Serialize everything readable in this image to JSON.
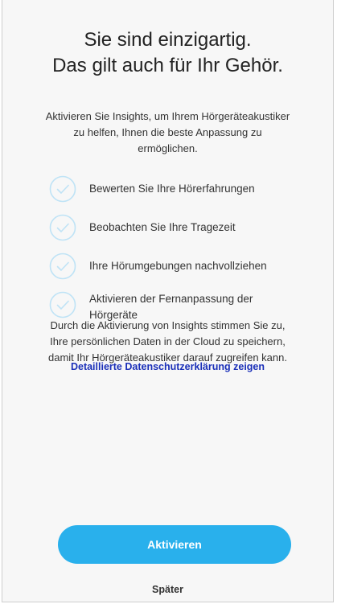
{
  "headline": {
    "line1": "Sie sind einzigartig.",
    "line2": "Das gilt auch für Ihr Gehör."
  },
  "intro": {
    "line1": "Aktivieren Sie Insights, um Ihrem Hörgeräteakustiker",
    "line2": "zu helfen, Ihnen die beste Anpassung zu",
    "line3": "ermöglichen."
  },
  "features": [
    {
      "icon": "check-circle-icon",
      "label": "Bewerten Sie Ihre Hörerfahrungen"
    },
    {
      "icon": "check-circle-icon",
      "label": "Beobachten Sie Ihre Tragezeit"
    },
    {
      "icon": "check-circle-icon",
      "label": "Ihre Hörumgebungen nachvollziehen"
    },
    {
      "icon": "check-circle-icon",
      "label": "Aktivieren der Fernanpassung der Hörgeräte"
    }
  ],
  "consent": {
    "line1": "Durch die Aktivierung von Insights stimmen Sie zu,",
    "line2": "Ihre persönlichen Daten in der Cloud zu speichern,",
    "line3": "damit Ihr Hörgeräteakustiker darauf zugreifen kann."
  },
  "privacy_link": "Detaillierte Datenschutzerklärung zeigen",
  "activate_button": "Aktivieren",
  "later_link": "Später",
  "colors": {
    "accent": "#29b0ec",
    "link": "#1a2fb8",
    "check": "#bfe3f6",
    "background": "#f7f7f7"
  }
}
